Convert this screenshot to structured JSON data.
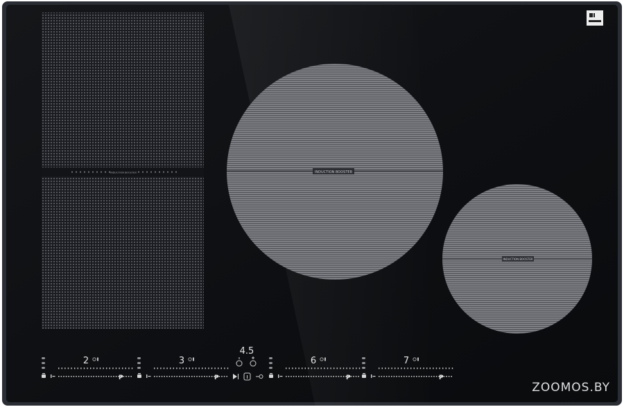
{
  "cooktop": {
    "surface_color": "#0f1115",
    "frame_color": "#2a2d33",
    "zone_color": "#7f8187",
    "booster_label": "INDUCTION BOOSTER",
    "flex_booster_label": "INDUCTION BOOSTER"
  },
  "controls": {
    "center_timer": "4.5",
    "zones": [
      {
        "level": "2",
        "power_label": "P",
        "icon": "slider-scale"
      },
      {
        "level": "3",
        "power_label": "P",
        "icon": "slider-scale"
      },
      {
        "level": "6",
        "power_label": "P",
        "icon": "slider-scale"
      },
      {
        "level": "7",
        "power_label": "P",
        "icon": "slider-scale"
      }
    ],
    "center_icons": [
      "play-pause-icon",
      "info-icon",
      "lock-icon",
      "timer-minus-icon",
      "timer-plus-icon"
    ]
  },
  "watermark": {
    "text": "ZOOMOS.BY"
  }
}
